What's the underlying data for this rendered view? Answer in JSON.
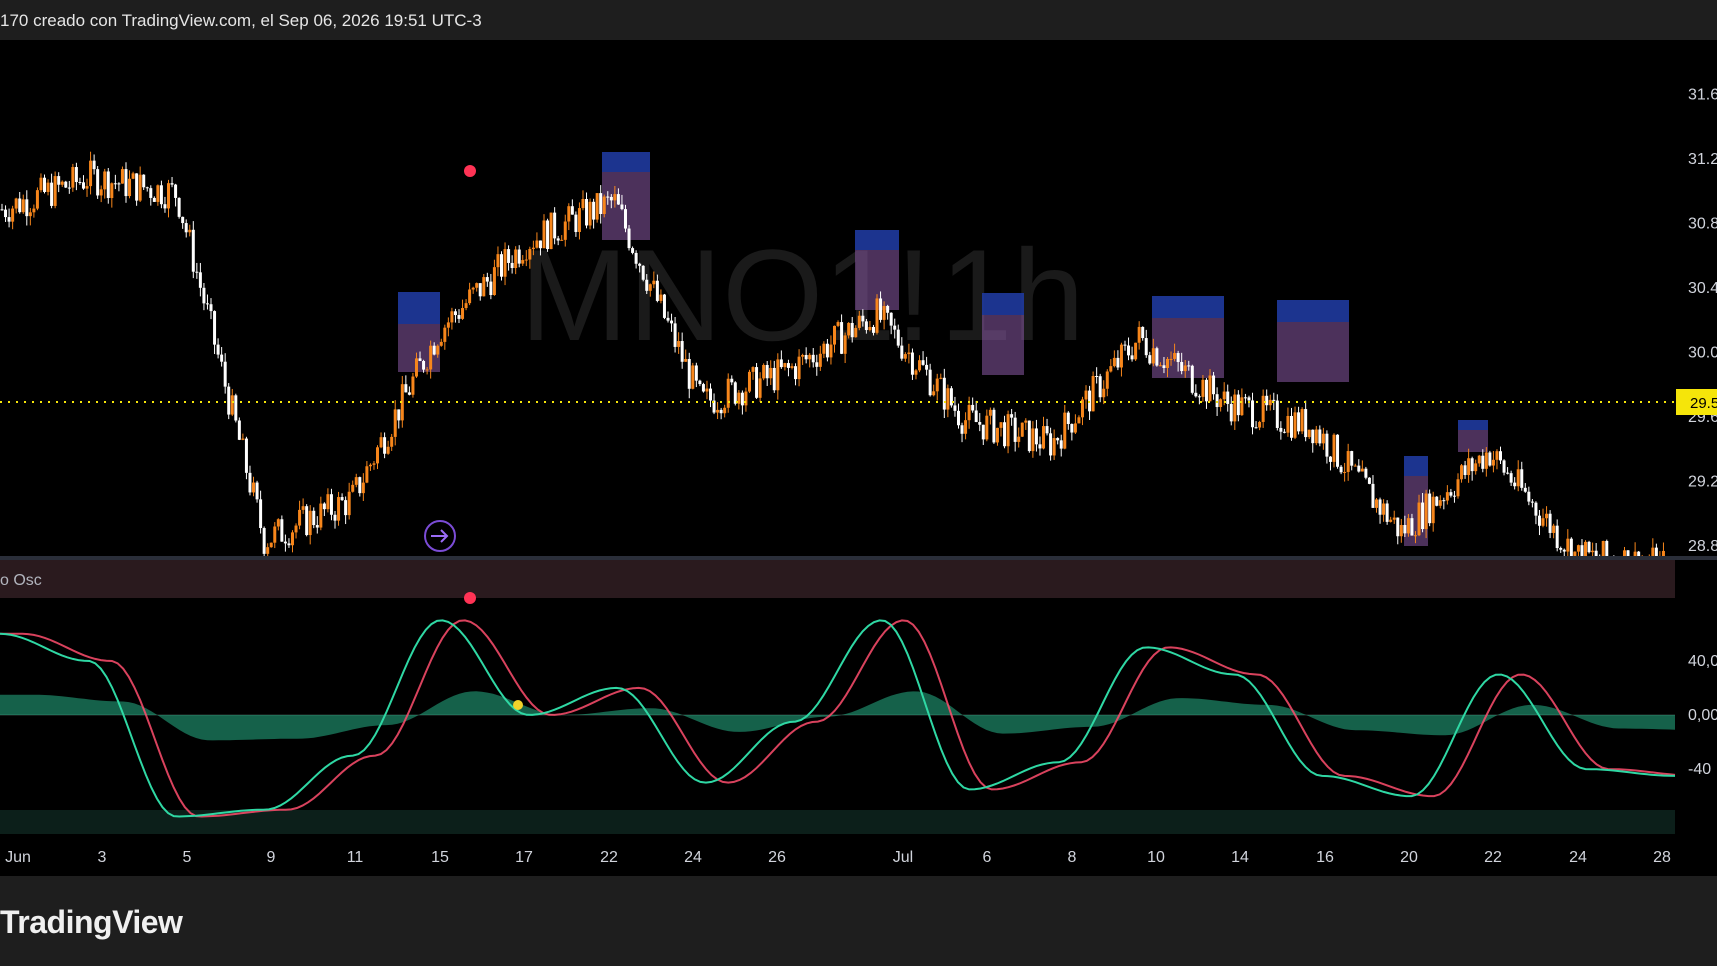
{
  "header": {
    "caption": "170 creado con TradingView.com, el Sep 06, 2026 19:51 UTC-3"
  },
  "watermark": {
    "symbol": "MNO1!",
    "interval": "1h"
  },
  "colors": {
    "up": "#f7861b",
    "down": "#ffffff",
    "price_line": "#f5e50a",
    "zone_blue": "#1f3a9e",
    "zone_purple": "#8a5aa5",
    "osc_green": "#2fd8a4",
    "osc_red": "#ff4d6d",
    "signal_red": "#ff3355",
    "signal_yellow": "#f0d22a"
  },
  "price_axis": {
    "ticks": [
      "31.6",
      "31.2",
      "30.8",
      "30.4",
      "30.0",
      "29.6",
      "29.2",
      "28.8"
    ],
    "current_price": "29.5"
  },
  "oscillator": {
    "title": "o Osc",
    "ticks": [
      "40,00",
      "0,00",
      "-40"
    ]
  },
  "time_axis": {
    "labels": [
      "Jun",
      "3",
      "5",
      "9",
      "11",
      "15",
      "17",
      "22",
      "24",
      "26",
      "Jul",
      "6",
      "8",
      "10",
      "14",
      "16",
      "20",
      "22",
      "24",
      "28"
    ]
  },
  "footer": {
    "brand": "TradingView"
  },
  "chart_data": {
    "type": "candlestick",
    "series": [
      {
        "name": "price",
        "x": [
          "Jun",
          "3",
          "5",
          "9",
          "11",
          "15",
          "17",
          "22",
          "24",
          "26",
          "Jul",
          "6",
          "8",
          "10",
          "14",
          "16",
          "20",
          "22",
          "24",
          "28"
        ],
        "values": [
          30.75,
          30.95,
          30.85,
          28.7,
          28.95,
          30.0,
          30.55,
          30.8,
          29.55,
          29.75,
          30.1,
          29.45,
          29.3,
          29.95,
          29.55,
          29.4,
          28.75,
          29.25,
          28.6,
          28.55
        ]
      },
      {
        "name": "oscillator",
        "x": [
          "Jun",
          "3",
          "5",
          "9",
          "11",
          "15",
          "17",
          "22",
          "24",
          "26",
          "Jul",
          "6",
          "8",
          "10",
          "14",
          "16",
          "20",
          "22",
          "24",
          "28"
        ],
        "values": [
          60,
          40,
          -75,
          -70,
          -30,
          70,
          0,
          20,
          -50,
          -5,
          70,
          -55,
          -35,
          50,
          30,
          -45,
          -60,
          30,
          -40,
          -45
        ]
      }
    ],
    "ylim": [
      28.6,
      31.8
    ],
    "osc_ylim": [
      -85,
      85
    ],
    "grid": false,
    "legend": "none"
  }
}
